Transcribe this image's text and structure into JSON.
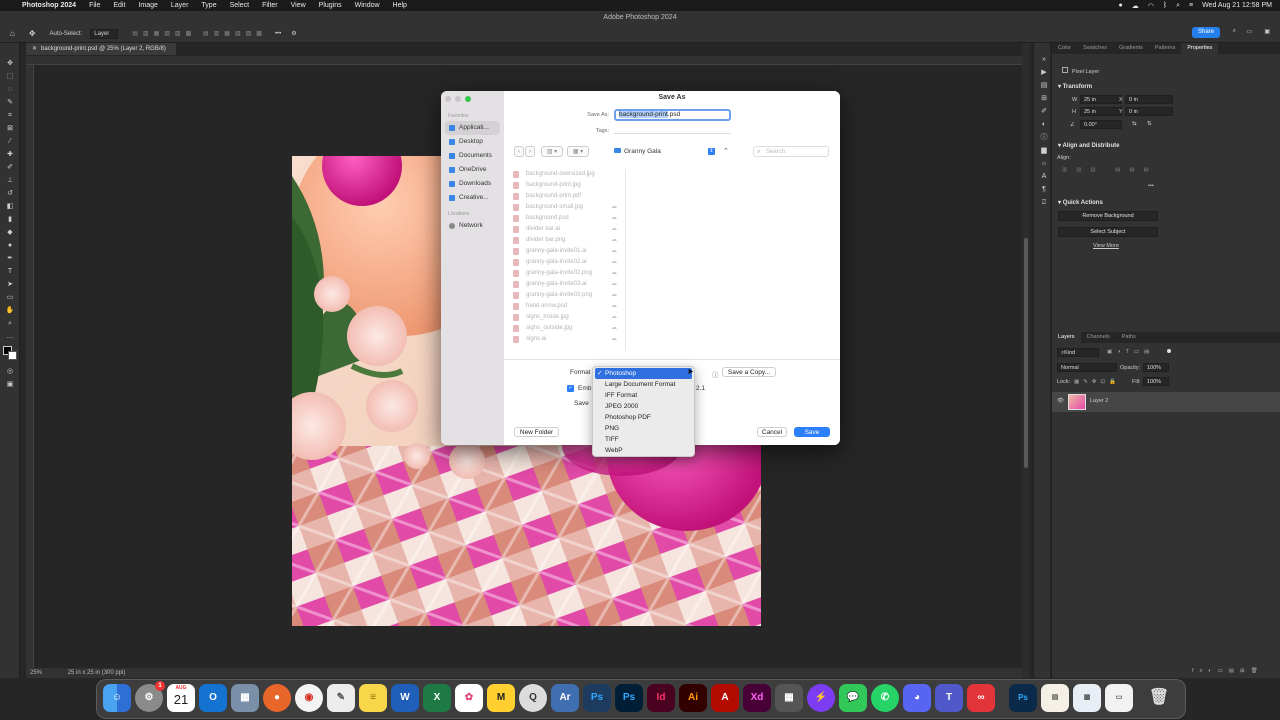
{
  "menubar": {
    "app": "Photoshop 2024",
    "items": [
      "File",
      "Edit",
      "Image",
      "Layer",
      "Type",
      "Select",
      "Filter",
      "View",
      "Plugins",
      "Window",
      "Help"
    ],
    "clock": "Wed Aug 21  12:58 PM"
  },
  "window": {
    "title": "Adobe Photoshop 2024"
  },
  "options": {
    "auto_select_label": "Auto-Select:",
    "auto_select_value": "Layer",
    "share_label": "Share"
  },
  "document": {
    "tab_label": "background-print.psd @ 25% (Layer 2, RGB/8)",
    "zoom": "25%",
    "doc_info": "25 in x 25 in (300 ppi)"
  },
  "dialog": {
    "title": "Save As",
    "save_as_label": "Save As:",
    "filename_selected": "background-print",
    "filename_ext": ".psd",
    "tags_label": "Tags:",
    "location": "Granny Gala",
    "search_placeholder": "Search",
    "sidebar": {
      "favorites_header": "Favorites",
      "favorites": [
        "Applicati...",
        "Desktop",
        "Documents",
        "OneDrive",
        "Downloads",
        "Creative..."
      ],
      "locations_header": "Locations",
      "locations": [
        "Network"
      ]
    },
    "files": [
      "background-oversized.jpg",
      "background-print.jpg",
      "background-print.pdf",
      "background-small.jpg",
      "background.psd",
      "divider bar.ai",
      "divider bar.png",
      "granny-gala-invite01.ai",
      "granny-gala-invite02.ai",
      "granny-gala-invite02.png",
      "granny-gala-invite03.ai",
      "granny-gala-invite03.png",
      "hand arrow.psd",
      "signs_inside.jpg",
      "signs_outside.jpg",
      "signs.ai"
    ],
    "format_label": "Format",
    "save_copy_label": "Save a Copy...",
    "embed_label": "Emb",
    "embed_tail": "2.1",
    "save_partial": "Save",
    "new_folder_label": "New Folder",
    "cancel_label": "Cancel",
    "save_label": "Save"
  },
  "format_dropdown": {
    "selected": "Photoshop",
    "options": [
      "Photoshop",
      "Large Document Format",
      "IFF Format",
      "JPEG 2000",
      "Photoshop PDF",
      "PNG",
      "TIFF",
      "WebP"
    ]
  },
  "properties_panel": {
    "tabs": [
      "Color",
      "Swatches",
      "Gradients",
      "Patterns",
      "Properties"
    ],
    "kind": "Pixel Layer",
    "transform_header": "Transform",
    "w_label": "W",
    "w_value": "25 in",
    "h_label": "H",
    "h_value": "25 in",
    "x_label": "X",
    "x_value": "0 in",
    "y_label": "Y",
    "y_value": "0 in",
    "angle_value": "0.00°",
    "align_header": "Align and Distribute",
    "align_label": "Align:",
    "quick_actions_header": "Quick Actions",
    "remove_bg": "Remove Background",
    "select_subject": "Select Subject",
    "view_more": "View More"
  },
  "layers_panel": {
    "tabs": [
      "Layers",
      "Channels",
      "Paths"
    ],
    "kind_filter": "Kind",
    "blend_mode": "Normal",
    "opacity_label": "Opacity:",
    "opacity_value": "100%",
    "lock_label": "Lock:",
    "fill_label": "Fill:",
    "fill_value": "100%",
    "layers": [
      {
        "name": "Layer 2"
      }
    ]
  },
  "dock": {
    "apps": [
      "Finder",
      "System Settings",
      "Calendar",
      "Outlook",
      "Preview",
      "Firefox",
      "Chrome",
      "TextEdit",
      "Notes",
      "Word",
      "Excel",
      "Mindmap",
      "Miro",
      "QuickTime",
      "Adobe Fonts",
      "Photoshop",
      "Photoshop Beta",
      "InDesign",
      "Illustrator",
      "Acrobat",
      "Adobe XD",
      "Calculator",
      "Messenger",
      "Messages",
      "WhatsApp",
      "Discord",
      "Teams",
      "Creative Cloud",
      "PSD File",
      "Screenshot 1",
      "Screenshot 2",
      "Screenshot 3",
      "Trash"
    ],
    "calendar_month": "AUG",
    "calendar_day": "21",
    "settings_badge": "1"
  }
}
